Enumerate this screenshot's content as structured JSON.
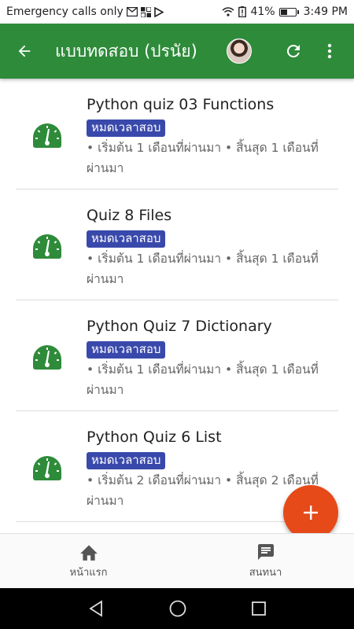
{
  "status_bar": {
    "carrier": "Emergency calls only",
    "battery_percent": "41%",
    "battery_level": 0.41,
    "time": "3:49 PM"
  },
  "app_bar": {
    "title": "แบบทดสอบ (ปรนัย)",
    "icons": [
      "arrow-back-icon",
      "avatar",
      "refresh-icon",
      "more-vert-icon"
    ]
  },
  "quizzes": [
    {
      "name": "Python quiz 03 Functions",
      "status": "หมดเวลาสอบ",
      "meta": "• เริ่มต้น 1 เดือนที่ผ่านมา • สิ้นสุด 1 เดือนที่ผ่านมา"
    },
    {
      "name": "Quiz 8 Files",
      "status": "หมดเวลาสอบ",
      "meta": "• เริ่มต้น 1 เดือนที่ผ่านมา • สิ้นสุด 1 เดือนที่ผ่านมา"
    },
    {
      "name": "Python Quiz 7 Dictionary",
      "status": "หมดเวลาสอบ",
      "meta": "• เริ่มต้น 1 เดือนที่ผ่านมา • สิ้นสุด 1 เดือนที่ผ่านมา"
    },
    {
      "name": "Python Quiz 6 List",
      "status": "หมดเวลาสอบ",
      "meta": "• เริ่มต้น 2 เดือนที่ผ่านมา • สิ้นสุด 2 เดือนที่ผ่านมา"
    }
  ],
  "fab": {
    "icon": "add-icon"
  },
  "bottom_nav": [
    {
      "label": "หน้าแรก",
      "icon": "home-icon"
    },
    {
      "label": "สนทนา",
      "icon": "chat-icon"
    }
  ],
  "colors": {
    "app_bar": "#2e8b3a",
    "quiz_icon": "#2e8b3a",
    "badge": "#3949ab",
    "fab": "#e64a19"
  }
}
